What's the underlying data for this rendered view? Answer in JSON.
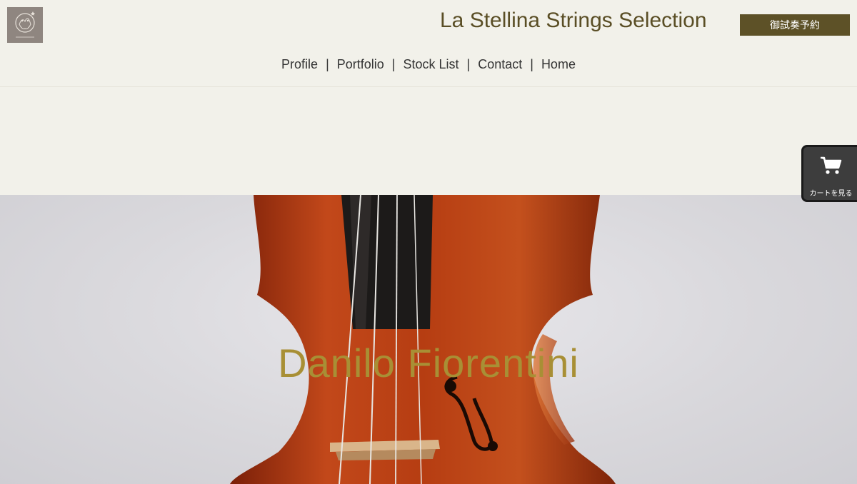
{
  "header": {
    "logo_alt": "La Stellina Strings logo",
    "site_title": "La Stellina Strings Selection",
    "reserve_button": "御試奏予約"
  },
  "nav": {
    "items": [
      {
        "label": "Profile"
      },
      {
        "label": "Portfolio"
      },
      {
        "label": "Stock List"
      },
      {
        "label": "Contact"
      },
      {
        "label": "Home"
      }
    ],
    "separator": "|"
  },
  "hero": {
    "title": "Danilo Fiorentini",
    "title_color": "#a88f35"
  },
  "cart": {
    "label": "カートを見る",
    "icon": "cart-icon"
  },
  "colors": {
    "background": "#f2f1ea",
    "brand": "#5d5127",
    "title_text": "#5a4e25"
  }
}
